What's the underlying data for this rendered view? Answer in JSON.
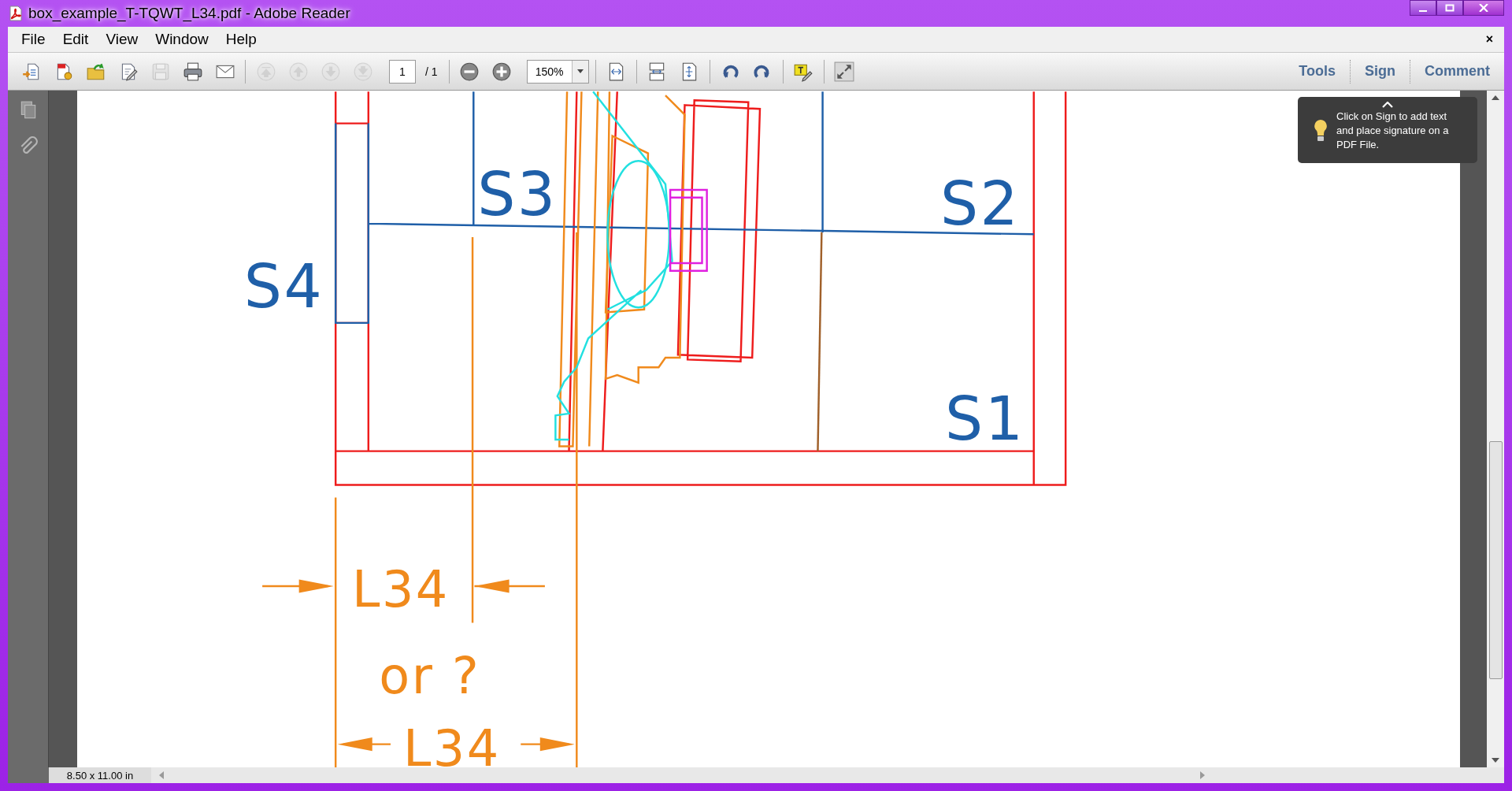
{
  "window": {
    "title": "box_example_T-TQWT_L34.pdf - Adobe Reader"
  },
  "menu": {
    "items": [
      "File",
      "Edit",
      "View",
      "Window",
      "Help"
    ],
    "close": "×"
  },
  "toolbar": {
    "groups": [
      {
        "kind": "buttons",
        "buttons": [
          {
            "disabled": false
          },
          {
            "disabled": false
          },
          {
            "disabled": false
          },
          {
            "disabled": false
          },
          {
            "disabled": true
          },
          {
            "disabled": false
          },
          {
            "disabled": false
          }
        ]
      },
      {
        "kind": "page",
        "buttons": [
          {
            "disabled": true
          },
          {
            "disabled": true
          },
          {
            "disabled": true
          },
          {
            "disabled": true
          }
        ],
        "field": "1",
        "suffix": "/ 1"
      },
      {
        "kind": "zoom",
        "buttons": [
          {
            "disabled": false
          },
          {
            "disabled": false
          }
        ],
        "field": "150%"
      },
      {
        "kind": "buttons",
        "buttons": [
          {
            "disabled": false
          }
        ]
      },
      {
        "kind": "buttons",
        "buttons": [
          {
            "disabled": false
          },
          {
            "disabled": false
          }
        ]
      },
      {
        "kind": "buttons",
        "buttons": [
          {
            "disabled": false
          },
          {
            "disabled": false
          }
        ]
      },
      {
        "kind": "buttons",
        "buttons": [
          {
            "disabled": false
          }
        ]
      },
      {
        "kind": "buttons",
        "buttons": [
          {
            "disabled": false
          }
        ]
      }
    ],
    "panels": [
      "Tools",
      "Sign",
      "Comment"
    ]
  },
  "tooltip": {
    "text": "Click on Sign to add text and place signature on a PDF File."
  },
  "drawing": {
    "labels": [
      {
        "text": "S3",
        "kind": "section"
      },
      {
        "text": "S2",
        "kind": "section"
      },
      {
        "text": "S4",
        "kind": "section"
      },
      {
        "text": "S1",
        "kind": "section"
      },
      {
        "text": "L34",
        "kind": "dimension"
      },
      {
        "text": "or ?",
        "kind": "dimension"
      },
      {
        "text": "L34",
        "kind": "dimension"
      }
    ]
  },
  "status_bar": {
    "page_size": "8.50 x 11.00 in"
  }
}
